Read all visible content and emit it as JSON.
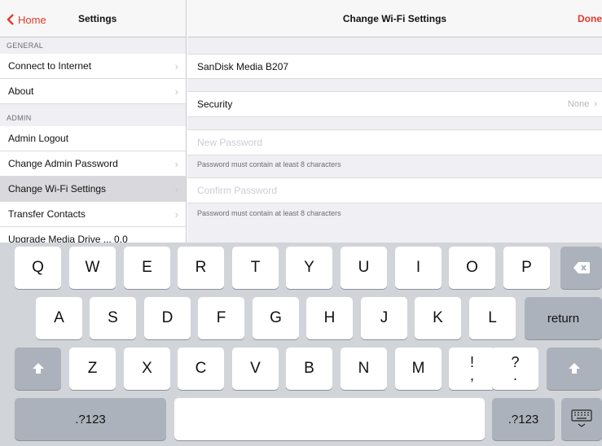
{
  "sidebar": {
    "back_label": "Home",
    "title": "Settings",
    "sections": [
      {
        "header": "GENERAL",
        "items": [
          {
            "label": "Connect to Internet"
          },
          {
            "label": "About"
          }
        ]
      },
      {
        "header": "ADMIN",
        "items": [
          {
            "label": "Admin Logout"
          },
          {
            "label": "Change Admin Password"
          },
          {
            "label": "Change Wi-Fi Settings"
          },
          {
            "label": "Transfer Contacts"
          },
          {
            "label": "Upgrade Media Drive ... 0.0"
          }
        ]
      }
    ]
  },
  "main": {
    "title": "Change Wi-Fi Settings",
    "done_label": "Done",
    "network_name": "SanDisk Media B207",
    "security_label": "Security",
    "security_value": "None",
    "new_password_placeholder": "New Password",
    "new_password_hint": "Password must contain at least 8 characters",
    "confirm_password_placeholder": "Confirm Password",
    "confirm_password_hint": "Password must contain at least 8 characters"
  },
  "keyboard": {
    "row1": [
      "Q",
      "W",
      "E",
      "R",
      "T",
      "Y",
      "U",
      "I",
      "O",
      "P"
    ],
    "row2": [
      "A",
      "S",
      "D",
      "F",
      "G",
      "H",
      "J",
      "K",
      "L"
    ],
    "row3": [
      "Z",
      "X",
      "C",
      "V",
      "B",
      "N",
      "M"
    ],
    "exclaim_top": "!",
    "exclaim_bottom": ",",
    "question_top": "?",
    "question_bottom": ".",
    "return_label": "return",
    "numbers_label": ".?123"
  },
  "colors": {
    "accent": "#e03a2e",
    "keyboard_bg": "#d1d4d9",
    "dark_key": "#acb2bb"
  },
  "icons": {
    "back": "chevron-left-icon",
    "delete": "backspace-icon",
    "shift": "shift-arrow-icon",
    "hide_keyboard": "keyboard-dismiss-icon",
    "disclosure": "chevron-right-icon"
  }
}
